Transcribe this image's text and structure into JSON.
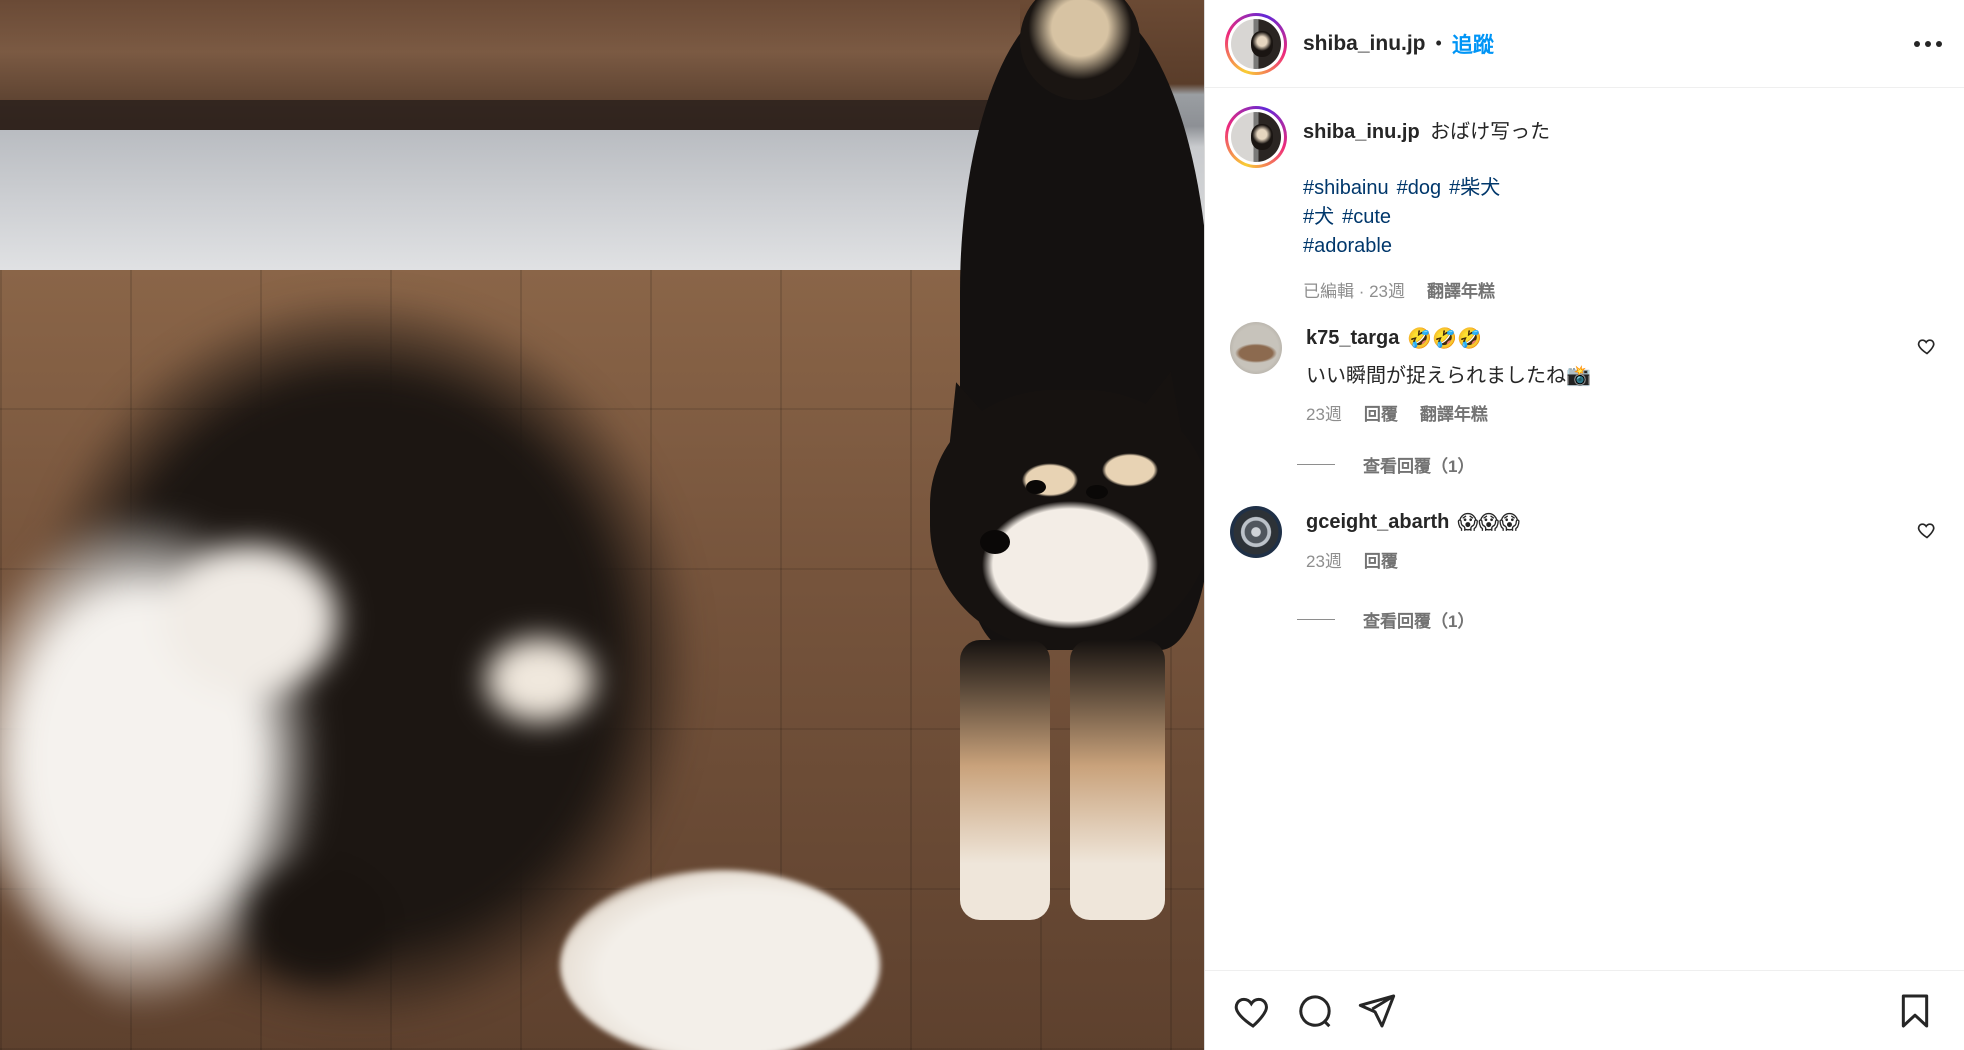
{
  "post": {
    "username": "shiba_inu.jp",
    "separator": "•",
    "follow_label": "追蹤"
  },
  "caption": {
    "username": "shiba_inu.jp",
    "text": "おばけ写った",
    "hashtags_line1": [
      "#shibainu",
      "#dog",
      "#柴犬"
    ],
    "hashtags_line2": [
      "#犬",
      "#cute"
    ],
    "hashtags_line3": [
      "#adorable"
    ],
    "meta": "已編輯 · 23週",
    "translate": "翻譯年糕"
  },
  "comments": [
    {
      "username": "k75_targa",
      "emoji": "🤣🤣🤣",
      "text": "いい瞬間が捉えられましたね📸",
      "time": "23週",
      "reply": "回覆",
      "translate": "翻譯年糕",
      "view_replies": "查看回覆（1）"
    },
    {
      "username": "gceight_abarth",
      "emoji": "😱😱😱",
      "time": "23週",
      "reply": "回覆",
      "view_replies": "查看回覆（1）"
    }
  ],
  "icons": {
    "like": "heart-icon",
    "comment": "comment-bubble-icon",
    "share": "paper-plane-icon",
    "save": "bookmark-icon",
    "more": "more-options-icon"
  },
  "colors": {
    "link_blue": "#0095f6",
    "hashtag_blue": "#00376b",
    "secondary_text": "#8e8e8e"
  }
}
